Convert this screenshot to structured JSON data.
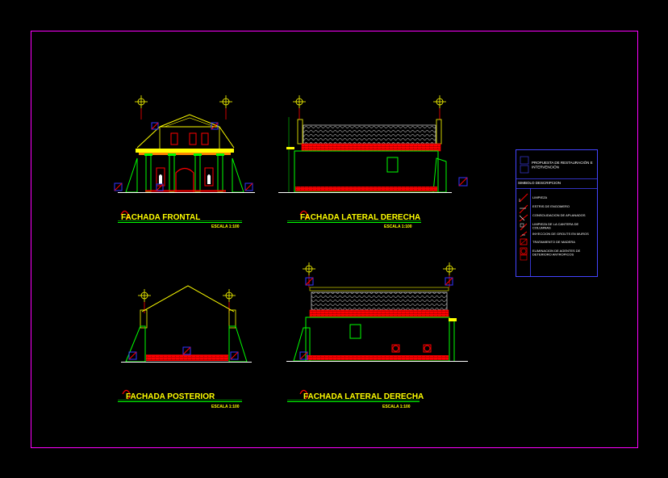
{
  "drawings": [
    {
      "title": "FACHADA FRONTAL",
      "scale": "ESCALA 1:100"
    },
    {
      "title": "FACHADA LATERAL DERECHA",
      "scale": "ESCALA 1:100"
    },
    {
      "title": "FACHADA POSTERIOR",
      "scale": "ESCALA 1:100"
    },
    {
      "title": "FACHADA LATERAL DERECHA",
      "scale": "ESCALA 1:100"
    }
  ],
  "legend": {
    "header_line1": "PROPUESTA DE RESTAURACIÓN E",
    "header_line2": "INTERVENCIÓN",
    "column_header": "SIMBOLO DESCRIPCION",
    "items": [
      "LIMPIEZA",
      "ESTRIS DE ENGOMERO",
      "CONSOLIDACION DE APLANADOS",
      "LIMPIEZA DE LA CANTERA DE",
      "COLUMNAS",
      "INYECCION DE GROUTS EN MUROS",
      "TRATAMIENTO DE MADERA",
      "ELIMINACION DE AGENTES DE",
      "DETERIORO ANTROPICOS"
    ]
  },
  "colors": {
    "frame": "#ff00ff",
    "line_green": "#00ff00",
    "line_yellow": "#ffff00",
    "line_red": "#ff0000",
    "line_blue": "#3333ff",
    "line_white": "#ffffff",
    "legend_border": "#4444ff"
  }
}
